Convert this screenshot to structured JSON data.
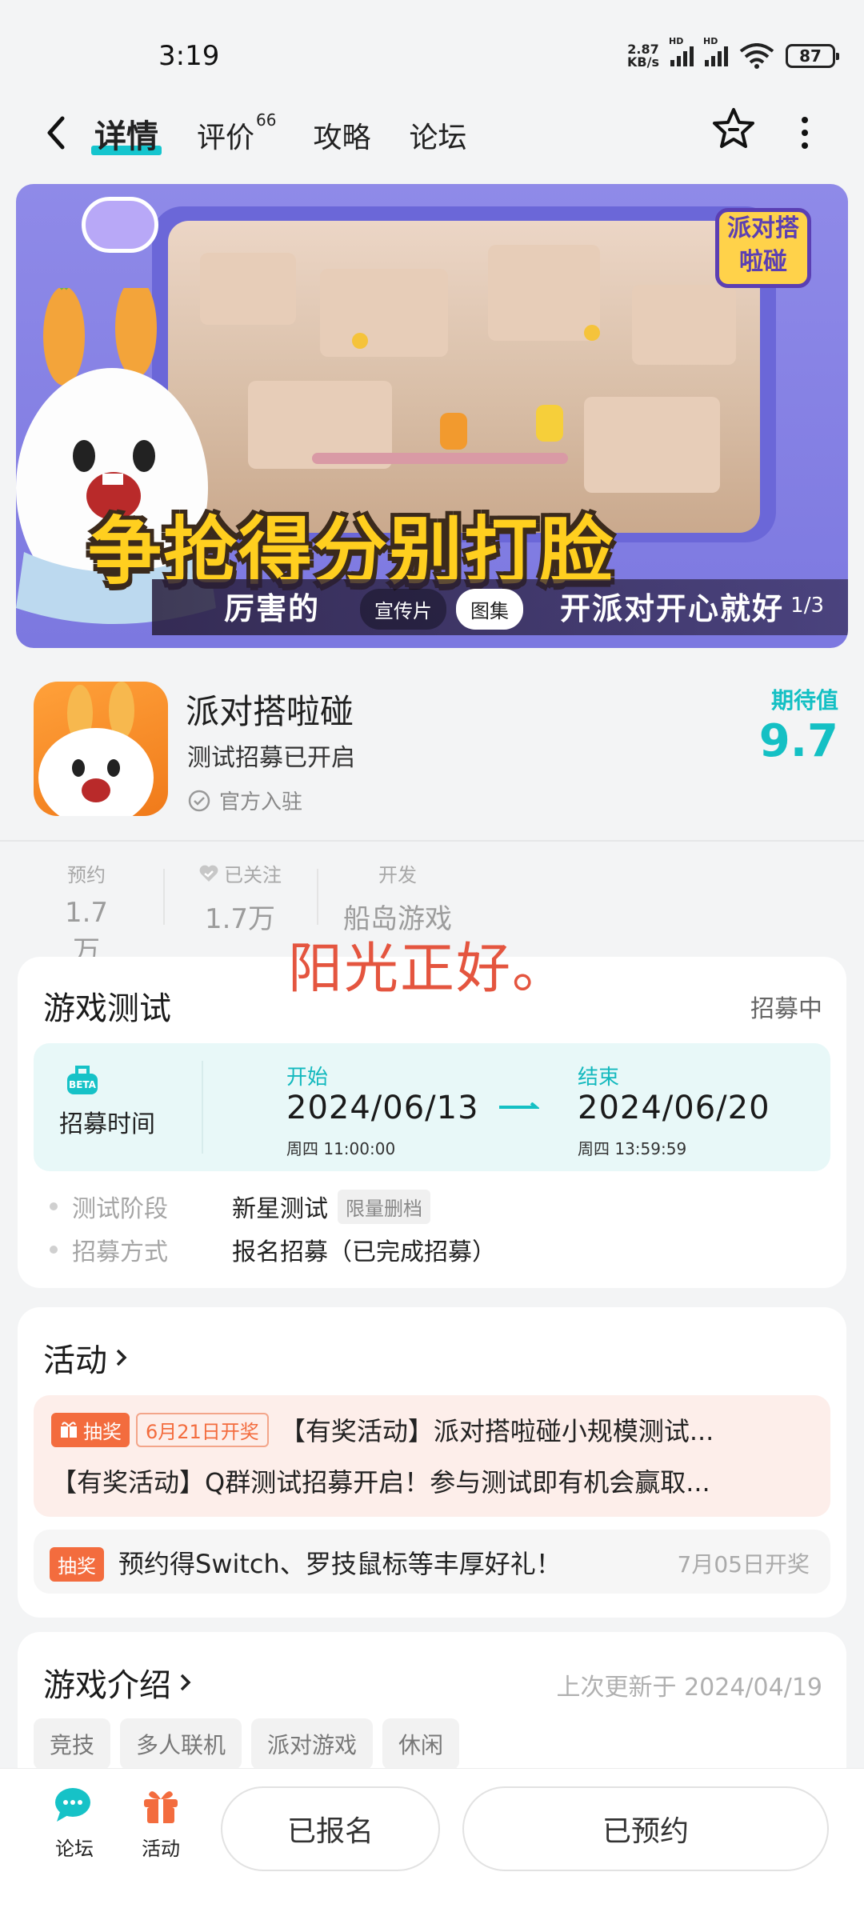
{
  "status_bar": {
    "time": "3:19",
    "net_speed_value": "2.87",
    "net_speed_unit": "KB/s",
    "hd1": "HD",
    "hd2": "HD",
    "battery": "87"
  },
  "nav": {
    "tabs": [
      {
        "label": "详情",
        "active": true
      },
      {
        "label": "评价",
        "badge": "66"
      },
      {
        "label": "攻略"
      },
      {
        "label": "论坛"
      }
    ]
  },
  "banner": {
    "headline": "争抢得分别打脸",
    "subline": "厉害的",
    "subline_end": "开派对开心就好",
    "pill_video": "宣传片",
    "pill_gallery": "图集",
    "counter": "1/3",
    "logo_text": "派对搭啦碰"
  },
  "app": {
    "name": "派对搭啦碰",
    "subtitle": "测试招募已开启",
    "verified": "官方入驻",
    "expect_label": "期待值",
    "expect_value": "9.7"
  },
  "stats": [
    {
      "label": "预约",
      "value": "1.7万"
    },
    {
      "label": "已关注",
      "value": "1.7万"
    },
    {
      "label": "开发",
      "value": "船岛游戏"
    }
  ],
  "overlay_text": "阳光正好。",
  "game_test": {
    "title": "游戏测试",
    "status": "招募中",
    "recruit_label": "招募时间",
    "start_label": "开始",
    "start_date": "2024/06/13",
    "start_time": "周四  11:00:00",
    "end_label": "结束",
    "end_date": "2024/06/20",
    "end_time": "周四  13:59:59",
    "stage_key": "测试阶段",
    "stage_value": "新星测试",
    "stage_tag": "限量删档",
    "method_key": "招募方式",
    "method_value": "报名招募（已完成招募）"
  },
  "activities": {
    "title": "活动",
    "item1_badge": "抽奖",
    "item1_date": "6月21日开奖",
    "item1_title": "【有奖活动】派对搭啦碰小规模测试...",
    "item1_desc": "【有奖活动】Q群测试招募开启！参与测试即有机会赢取...",
    "item2_badge": "抽奖",
    "item2_title": "预约得Switch、罗技鼠标等丰厚好礼！",
    "item2_date": "7月05日开奖"
  },
  "intro": {
    "title": "游戏介绍",
    "updated": "上次更新于 2024/04/19",
    "tags": [
      "竞技",
      "多人联机",
      "派对游戏",
      "休闲"
    ]
  },
  "bottom_bar": {
    "forum_label": "论坛",
    "activity_label": "活动",
    "signed_up": "已报名",
    "reserved": "已预约"
  },
  "colors": {
    "accent": "#14c0c4",
    "lottery": "#f36c3e",
    "overlay": "#e4553f"
  }
}
